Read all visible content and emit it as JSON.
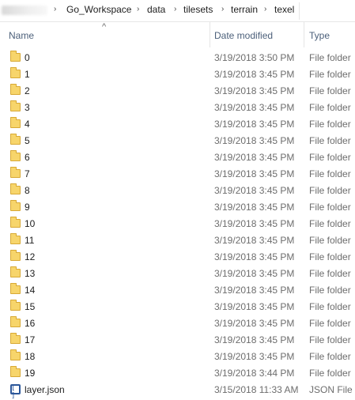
{
  "breadcrumb": [
    "Go_Workspace",
    "data",
    "tilesets",
    "terrain",
    "texel"
  ],
  "columns": {
    "name": "Name",
    "date": "Date modified",
    "type": "Type"
  },
  "files": [
    {
      "name": "0",
      "date": "3/19/2018 3:50 PM",
      "type": "File folder",
      "icon": "folder-icon"
    },
    {
      "name": "1",
      "date": "3/19/2018 3:45 PM",
      "type": "File folder",
      "icon": "folder-icon"
    },
    {
      "name": "2",
      "date": "3/19/2018 3:45 PM",
      "type": "File folder",
      "icon": "folder-icon"
    },
    {
      "name": "3",
      "date": "3/19/2018 3:45 PM",
      "type": "File folder",
      "icon": "folder-icon"
    },
    {
      "name": "4",
      "date": "3/19/2018 3:45 PM",
      "type": "File folder",
      "icon": "folder-icon"
    },
    {
      "name": "5",
      "date": "3/19/2018 3:45 PM",
      "type": "File folder",
      "icon": "folder-icon"
    },
    {
      "name": "6",
      "date": "3/19/2018 3:45 PM",
      "type": "File folder",
      "icon": "folder-icon"
    },
    {
      "name": "7",
      "date": "3/19/2018 3:45 PM",
      "type": "File folder",
      "icon": "folder-icon"
    },
    {
      "name": "8",
      "date": "3/19/2018 3:45 PM",
      "type": "File folder",
      "icon": "folder-icon"
    },
    {
      "name": "9",
      "date": "3/19/2018 3:45 PM",
      "type": "File folder",
      "icon": "folder-icon"
    },
    {
      "name": "10",
      "date": "3/19/2018 3:45 PM",
      "type": "File folder",
      "icon": "folder-icon"
    },
    {
      "name": "11",
      "date": "3/19/2018 3:45 PM",
      "type": "File folder",
      "icon": "folder-icon"
    },
    {
      "name": "12",
      "date": "3/19/2018 3:45 PM",
      "type": "File folder",
      "icon": "folder-icon"
    },
    {
      "name": "13",
      "date": "3/19/2018 3:45 PM",
      "type": "File folder",
      "icon": "folder-icon"
    },
    {
      "name": "14",
      "date": "3/19/2018 3:45 PM",
      "type": "File folder",
      "icon": "folder-icon"
    },
    {
      "name": "15",
      "date": "3/19/2018 3:45 PM",
      "type": "File folder",
      "icon": "folder-icon"
    },
    {
      "name": "16",
      "date": "3/19/2018 3:45 PM",
      "type": "File folder",
      "icon": "folder-icon"
    },
    {
      "name": "17",
      "date": "3/19/2018 3:45 PM",
      "type": "File folder",
      "icon": "folder-icon"
    },
    {
      "name": "18",
      "date": "3/19/2018 3:45 PM",
      "type": "File folder",
      "icon": "folder-icon"
    },
    {
      "name": "19",
      "date": "3/19/2018 3:44 PM",
      "type": "File folder",
      "icon": "folder-icon"
    },
    {
      "name": "layer.json",
      "date": "3/15/2018 11:33 AM",
      "type": "JSON File",
      "icon": "json-file-icon"
    }
  ]
}
